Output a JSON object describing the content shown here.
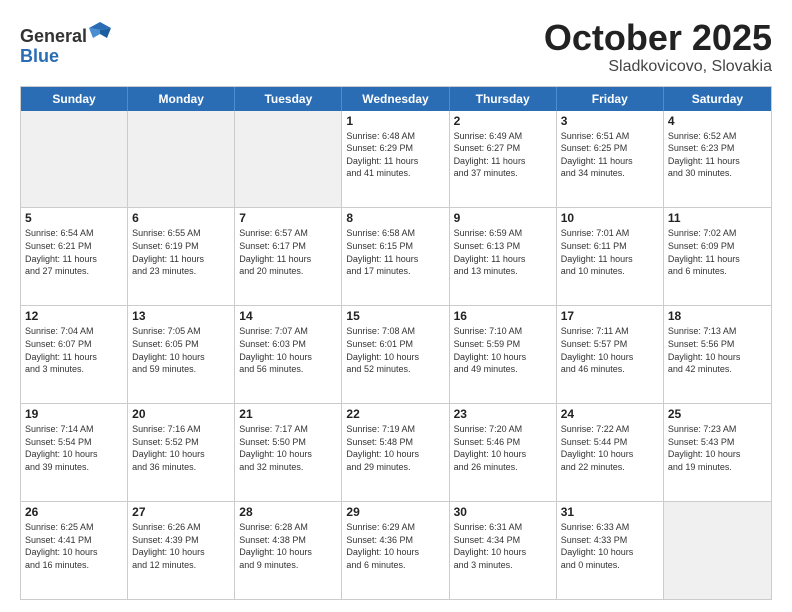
{
  "header": {
    "logo_line1": "General",
    "logo_line2": "Blue",
    "title": "October 2025",
    "subtitle": "Sladkovicovo, Slovakia"
  },
  "days_of_week": [
    "Sunday",
    "Monday",
    "Tuesday",
    "Wednesday",
    "Thursday",
    "Friday",
    "Saturday"
  ],
  "weeks": [
    [
      {
        "day": "",
        "text": "",
        "shaded": true
      },
      {
        "day": "",
        "text": "",
        "shaded": true
      },
      {
        "day": "",
        "text": "",
        "shaded": true
      },
      {
        "day": "1",
        "text": "Sunrise: 6:48 AM\nSunset: 6:29 PM\nDaylight: 11 hours\nand 41 minutes.",
        "shaded": false
      },
      {
        "day": "2",
        "text": "Sunrise: 6:49 AM\nSunset: 6:27 PM\nDaylight: 11 hours\nand 37 minutes.",
        "shaded": false
      },
      {
        "day": "3",
        "text": "Sunrise: 6:51 AM\nSunset: 6:25 PM\nDaylight: 11 hours\nand 34 minutes.",
        "shaded": false
      },
      {
        "day": "4",
        "text": "Sunrise: 6:52 AM\nSunset: 6:23 PM\nDaylight: 11 hours\nand 30 minutes.",
        "shaded": false
      }
    ],
    [
      {
        "day": "5",
        "text": "Sunrise: 6:54 AM\nSunset: 6:21 PM\nDaylight: 11 hours\nand 27 minutes.",
        "shaded": false
      },
      {
        "day": "6",
        "text": "Sunrise: 6:55 AM\nSunset: 6:19 PM\nDaylight: 11 hours\nand 23 minutes.",
        "shaded": false
      },
      {
        "day": "7",
        "text": "Sunrise: 6:57 AM\nSunset: 6:17 PM\nDaylight: 11 hours\nand 20 minutes.",
        "shaded": false
      },
      {
        "day": "8",
        "text": "Sunrise: 6:58 AM\nSunset: 6:15 PM\nDaylight: 11 hours\nand 17 minutes.",
        "shaded": false
      },
      {
        "day": "9",
        "text": "Sunrise: 6:59 AM\nSunset: 6:13 PM\nDaylight: 11 hours\nand 13 minutes.",
        "shaded": false
      },
      {
        "day": "10",
        "text": "Sunrise: 7:01 AM\nSunset: 6:11 PM\nDaylight: 11 hours\nand 10 minutes.",
        "shaded": false
      },
      {
        "day": "11",
        "text": "Sunrise: 7:02 AM\nSunset: 6:09 PM\nDaylight: 11 hours\nand 6 minutes.",
        "shaded": false
      }
    ],
    [
      {
        "day": "12",
        "text": "Sunrise: 7:04 AM\nSunset: 6:07 PM\nDaylight: 11 hours\nand 3 minutes.",
        "shaded": false
      },
      {
        "day": "13",
        "text": "Sunrise: 7:05 AM\nSunset: 6:05 PM\nDaylight: 10 hours\nand 59 minutes.",
        "shaded": false
      },
      {
        "day": "14",
        "text": "Sunrise: 7:07 AM\nSunset: 6:03 PM\nDaylight: 10 hours\nand 56 minutes.",
        "shaded": false
      },
      {
        "day": "15",
        "text": "Sunrise: 7:08 AM\nSunset: 6:01 PM\nDaylight: 10 hours\nand 52 minutes.",
        "shaded": false
      },
      {
        "day": "16",
        "text": "Sunrise: 7:10 AM\nSunset: 5:59 PM\nDaylight: 10 hours\nand 49 minutes.",
        "shaded": false
      },
      {
        "day": "17",
        "text": "Sunrise: 7:11 AM\nSunset: 5:57 PM\nDaylight: 10 hours\nand 46 minutes.",
        "shaded": false
      },
      {
        "day": "18",
        "text": "Sunrise: 7:13 AM\nSunset: 5:56 PM\nDaylight: 10 hours\nand 42 minutes.",
        "shaded": false
      }
    ],
    [
      {
        "day": "19",
        "text": "Sunrise: 7:14 AM\nSunset: 5:54 PM\nDaylight: 10 hours\nand 39 minutes.",
        "shaded": false
      },
      {
        "day": "20",
        "text": "Sunrise: 7:16 AM\nSunset: 5:52 PM\nDaylight: 10 hours\nand 36 minutes.",
        "shaded": false
      },
      {
        "day": "21",
        "text": "Sunrise: 7:17 AM\nSunset: 5:50 PM\nDaylight: 10 hours\nand 32 minutes.",
        "shaded": false
      },
      {
        "day": "22",
        "text": "Sunrise: 7:19 AM\nSunset: 5:48 PM\nDaylight: 10 hours\nand 29 minutes.",
        "shaded": false
      },
      {
        "day": "23",
        "text": "Sunrise: 7:20 AM\nSunset: 5:46 PM\nDaylight: 10 hours\nand 26 minutes.",
        "shaded": false
      },
      {
        "day": "24",
        "text": "Sunrise: 7:22 AM\nSunset: 5:44 PM\nDaylight: 10 hours\nand 22 minutes.",
        "shaded": false
      },
      {
        "day": "25",
        "text": "Sunrise: 7:23 AM\nSunset: 5:43 PM\nDaylight: 10 hours\nand 19 minutes.",
        "shaded": false
      }
    ],
    [
      {
        "day": "26",
        "text": "Sunrise: 6:25 AM\nSunset: 4:41 PM\nDaylight: 10 hours\nand 16 minutes.",
        "shaded": false
      },
      {
        "day": "27",
        "text": "Sunrise: 6:26 AM\nSunset: 4:39 PM\nDaylight: 10 hours\nand 12 minutes.",
        "shaded": false
      },
      {
        "day": "28",
        "text": "Sunrise: 6:28 AM\nSunset: 4:38 PM\nDaylight: 10 hours\nand 9 minutes.",
        "shaded": false
      },
      {
        "day": "29",
        "text": "Sunrise: 6:29 AM\nSunset: 4:36 PM\nDaylight: 10 hours\nand 6 minutes.",
        "shaded": false
      },
      {
        "day": "30",
        "text": "Sunrise: 6:31 AM\nSunset: 4:34 PM\nDaylight: 10 hours\nand 3 minutes.",
        "shaded": false
      },
      {
        "day": "31",
        "text": "Sunrise: 6:33 AM\nSunset: 4:33 PM\nDaylight: 10 hours\nand 0 minutes.",
        "shaded": false
      },
      {
        "day": "",
        "text": "",
        "shaded": true
      }
    ]
  ]
}
